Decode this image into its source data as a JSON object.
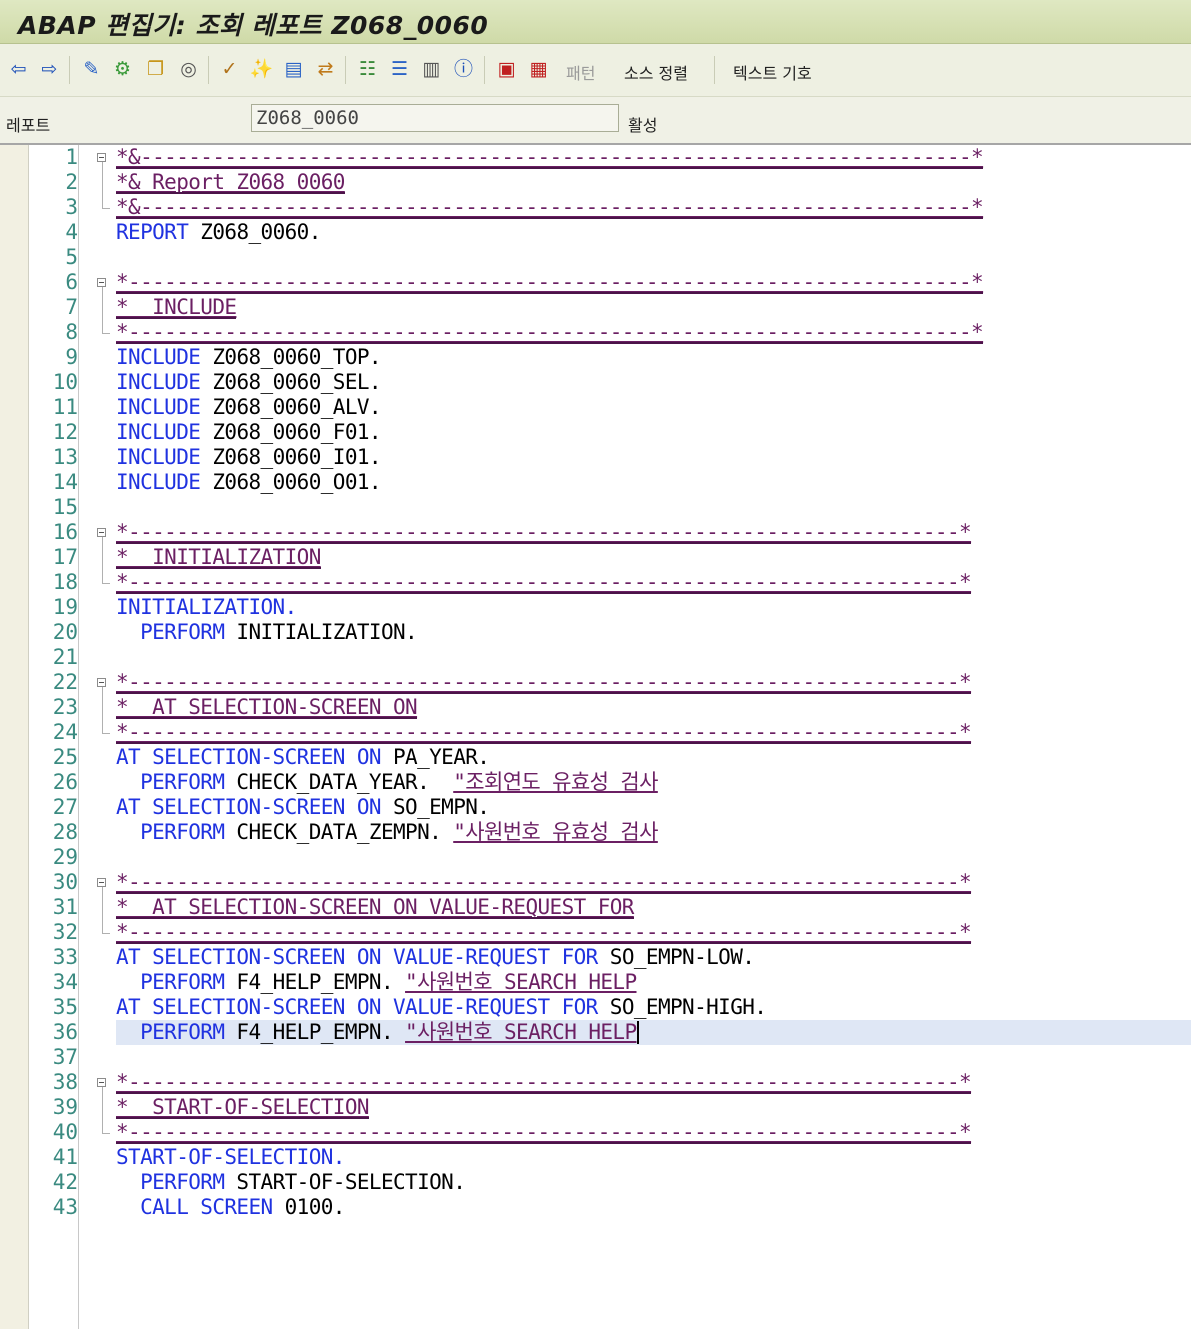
{
  "window": {
    "title": "ABAP 편집기: 조회 레포트 Z068_0060"
  },
  "toolbar": {
    "icons": [
      "back-arrow-icon",
      "forward-arrow-icon",
      "display-change-icon",
      "active-inactive-icon",
      "other-object-icon",
      "where-used-icon",
      "check-icon",
      "activate-icon",
      "test-icon",
      "where-used-list-icon",
      "object-list-icon",
      "navigation-icon",
      "enhancement-icon",
      "info-icon",
      "breakpoint-icon",
      "session-breakpoint-icon"
    ],
    "pattern_label": "패턴",
    "pretty_printer_label": "소스 정렬",
    "text_elements_label": "텍스트 기호"
  },
  "field": {
    "label": "레포트",
    "value": "Z068_0060",
    "status": "활성"
  },
  "editor": {
    "line_numbers": [
      "1",
      "2",
      "3",
      "4",
      "5",
      "6",
      "7",
      "8",
      "9",
      "10",
      "11",
      "12",
      "13",
      "14",
      "15",
      "16",
      "17",
      "18",
      "19",
      "20",
      "21",
      "22",
      "23",
      "24",
      "25",
      "26",
      "27",
      "28",
      "29",
      "30",
      "31",
      "32",
      "33",
      "34",
      "35",
      "36",
      "37",
      "38",
      "39",
      "40",
      "41",
      "42",
      "43"
    ],
    "cursor_line": 36,
    "lines": [
      {
        "n": 1,
        "tokens": [
          {
            "t": "*&---------------------------------------------------------------------*",
            "c": "cm"
          }
        ]
      },
      {
        "n": 2,
        "tokens": [
          {
            "t": "*& Report Z068_0060",
            "c": "cm"
          }
        ]
      },
      {
        "n": 3,
        "tokens": [
          {
            "t": "*&---------------------------------------------------------------------*",
            "c": "cm"
          }
        ]
      },
      {
        "n": 4,
        "tokens": [
          {
            "t": "REPORT",
            "c": "kw"
          },
          {
            "t": " Z068_0060.",
            "c": "obj"
          }
        ]
      },
      {
        "n": 5,
        "tokens": []
      },
      {
        "n": 6,
        "tokens": [
          {
            "t": "*----------------------------------------------------------------------*",
            "c": "cm"
          }
        ]
      },
      {
        "n": 7,
        "tokens": [
          {
            "t": "*  INCLUDE",
            "c": "cm"
          }
        ]
      },
      {
        "n": 8,
        "tokens": [
          {
            "t": "*----------------------------------------------------------------------*",
            "c": "cm"
          }
        ]
      },
      {
        "n": 9,
        "tokens": [
          {
            "t": "INCLUDE",
            "c": "kw"
          },
          {
            "t": " Z068_0060_TOP.",
            "c": "obj"
          }
        ]
      },
      {
        "n": 10,
        "tokens": [
          {
            "t": "INCLUDE",
            "c": "kw"
          },
          {
            "t": " Z068_0060_SEL.",
            "c": "obj"
          }
        ]
      },
      {
        "n": 11,
        "tokens": [
          {
            "t": "INCLUDE",
            "c": "kw"
          },
          {
            "t": " Z068_0060_ALV.",
            "c": "obj"
          }
        ]
      },
      {
        "n": 12,
        "tokens": [
          {
            "t": "INCLUDE",
            "c": "kw"
          },
          {
            "t": " Z068_0060_F01.",
            "c": "obj"
          }
        ]
      },
      {
        "n": 13,
        "tokens": [
          {
            "t": "INCLUDE",
            "c": "kw"
          },
          {
            "t": " Z068_0060_I01.",
            "c": "obj"
          }
        ]
      },
      {
        "n": 14,
        "tokens": [
          {
            "t": "INCLUDE",
            "c": "kw"
          },
          {
            "t": " Z068_0060_O01.",
            "c": "obj"
          }
        ]
      },
      {
        "n": 15,
        "tokens": []
      },
      {
        "n": 16,
        "tokens": [
          {
            "t": "*---------------------------------------------------------------------*",
            "c": "cm"
          }
        ]
      },
      {
        "n": 17,
        "tokens": [
          {
            "t": "*  INITIALIZATION",
            "c": "cm"
          }
        ]
      },
      {
        "n": 18,
        "tokens": [
          {
            "t": "*---------------------------------------------------------------------*",
            "c": "cm"
          }
        ]
      },
      {
        "n": 19,
        "tokens": [
          {
            "t": "INITIALIZATION.",
            "c": "kw"
          }
        ]
      },
      {
        "n": 20,
        "tokens": [
          {
            "t": "  PERFORM",
            "c": "kw"
          },
          {
            "t": " INITIALIZATION.",
            "c": "obj"
          }
        ]
      },
      {
        "n": 21,
        "tokens": []
      },
      {
        "n": 22,
        "tokens": [
          {
            "t": "*---------------------------------------------------------------------*",
            "c": "cm"
          }
        ]
      },
      {
        "n": 23,
        "tokens": [
          {
            "t": "*  AT SELECTION-SCREEN ON",
            "c": "cm"
          }
        ]
      },
      {
        "n": 24,
        "tokens": [
          {
            "t": "*---------------------------------------------------------------------*",
            "c": "cm"
          }
        ]
      },
      {
        "n": 25,
        "tokens": [
          {
            "t": "AT SELECTION-SCREEN ON",
            "c": "kw"
          },
          {
            "t": " PA_YEAR.",
            "c": "obj"
          }
        ]
      },
      {
        "n": 26,
        "tokens": [
          {
            "t": "  PERFORM",
            "c": "kw"
          },
          {
            "t": " CHECK_DATA_YEAR.  ",
            "c": "obj"
          },
          {
            "t": "\"조회연도 유효성 검사",
            "c": "cm"
          }
        ]
      },
      {
        "n": 27,
        "tokens": [
          {
            "t": "AT SELECTION-SCREEN ON",
            "c": "kw"
          },
          {
            "t": " SO_EMPN.",
            "c": "obj"
          }
        ]
      },
      {
        "n": 28,
        "tokens": [
          {
            "t": "  PERFORM",
            "c": "kw"
          },
          {
            "t": " CHECK_DATA_ZEMPN. ",
            "c": "obj"
          },
          {
            "t": "\"사원번호 유효성 검사",
            "c": "cm"
          }
        ]
      },
      {
        "n": 29,
        "tokens": []
      },
      {
        "n": 30,
        "tokens": [
          {
            "t": "*---------------------------------------------------------------------*",
            "c": "cm"
          }
        ]
      },
      {
        "n": 31,
        "tokens": [
          {
            "t": "*  AT SELECTION-SCREEN ON VALUE-REQUEST FOR",
            "c": "cm"
          }
        ]
      },
      {
        "n": 32,
        "tokens": [
          {
            "t": "*---------------------------------------------------------------------*",
            "c": "cm"
          }
        ]
      },
      {
        "n": 33,
        "tokens": [
          {
            "t": "AT SELECTION-SCREEN ON VALUE-REQUEST FOR",
            "c": "kw"
          },
          {
            "t": " SO_EMPN-LOW.",
            "c": "obj"
          }
        ]
      },
      {
        "n": 34,
        "tokens": [
          {
            "t": "  PERFORM",
            "c": "kw"
          },
          {
            "t": " F4_HELP_EMPN. ",
            "c": "obj"
          },
          {
            "t": "\"사원번호 SEARCH HELP",
            "c": "cm"
          }
        ]
      },
      {
        "n": 35,
        "tokens": [
          {
            "t": "AT SELECTION-SCREEN ON VALUE-REQUEST FOR",
            "c": "kw"
          },
          {
            "t": " SO_EMPN-HIGH.",
            "c": "obj"
          }
        ]
      },
      {
        "n": 36,
        "tokens": [
          {
            "t": "  PERFORM",
            "c": "kw"
          },
          {
            "t": " F4_HELP_EMPN. ",
            "c": "obj"
          },
          {
            "t": "\"사원번호 SEARCH HELP",
            "c": "cm"
          }
        ]
      },
      {
        "n": 37,
        "tokens": []
      },
      {
        "n": 38,
        "tokens": [
          {
            "t": "*---------------------------------------------------------------------*",
            "c": "cm"
          }
        ]
      },
      {
        "n": 39,
        "tokens": [
          {
            "t": "*  START-OF-SELECTION",
            "c": "cm"
          }
        ]
      },
      {
        "n": 40,
        "tokens": [
          {
            "t": "*---------------------------------------------------------------------*",
            "c": "cm"
          }
        ]
      },
      {
        "n": 41,
        "tokens": [
          {
            "t": "START-OF-SELECTION.",
            "c": "kw"
          }
        ]
      },
      {
        "n": 42,
        "tokens": [
          {
            "t": "  PERFORM",
            "c": "kw"
          },
          {
            "t": " START-OF-SELECTION.",
            "c": "obj"
          }
        ]
      },
      {
        "n": 43,
        "tokens": [
          {
            "t": "  CALL SCREEN",
            "c": "kw"
          },
          {
            "t": " 0100.",
            "c": "obj"
          }
        ]
      }
    ]
  },
  "colors": {
    "keyword": "#1f32e0",
    "comment": "#6b1f63",
    "line_number": "#3a8a80",
    "title_bar": "#d6e0b5"
  }
}
